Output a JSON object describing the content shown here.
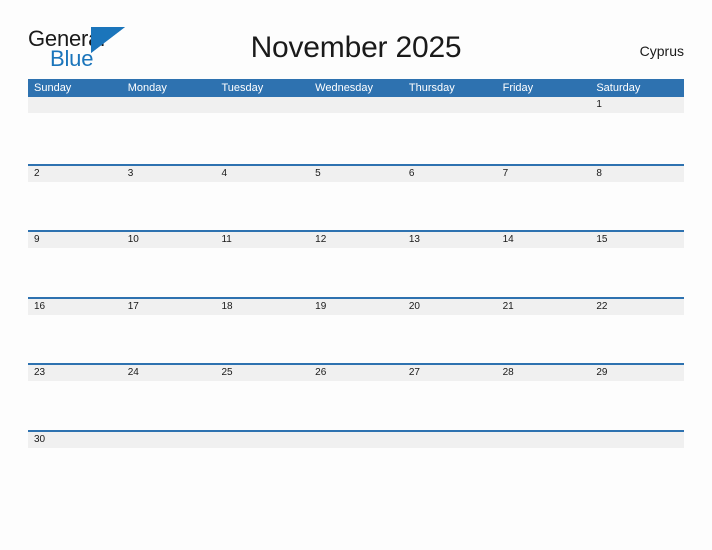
{
  "brand": {
    "text_primary": "General",
    "text_secondary": "Blue",
    "mark_icon": "triangle-flag-icon",
    "color_primary": "#1a1a1a",
    "color_secondary": "#1b75bb"
  },
  "header": {
    "title": "November 2025",
    "locale": "Cyprus"
  },
  "theme": {
    "accent": "#2e72b0",
    "date_band": "#f0f0f0",
    "page_background": "#fdfdfd",
    "text": "#1a1a1a",
    "header_text": "#ffffff"
  },
  "calendar": {
    "month": "November",
    "year": "2025",
    "weekdays": [
      "Sunday",
      "Monday",
      "Tuesday",
      "Wednesday",
      "Thursday",
      "Friday",
      "Saturday"
    ],
    "weeks": [
      {
        "days": [
          {
            "label": ""
          },
          {
            "label": ""
          },
          {
            "label": ""
          },
          {
            "label": ""
          },
          {
            "label": ""
          },
          {
            "label": ""
          },
          {
            "label": "1"
          }
        ]
      },
      {
        "days": [
          {
            "label": "2"
          },
          {
            "label": "3"
          },
          {
            "label": "4"
          },
          {
            "label": "5"
          },
          {
            "label": "6"
          },
          {
            "label": "7"
          },
          {
            "label": "8"
          }
        ]
      },
      {
        "days": [
          {
            "label": "9"
          },
          {
            "label": "10"
          },
          {
            "label": "11"
          },
          {
            "label": "12"
          },
          {
            "label": "13"
          },
          {
            "label": "14"
          },
          {
            "label": "15"
          }
        ]
      },
      {
        "days": [
          {
            "label": "16"
          },
          {
            "label": "17"
          },
          {
            "label": "18"
          },
          {
            "label": "19"
          },
          {
            "label": "20"
          },
          {
            "label": "21"
          },
          {
            "label": "22"
          }
        ]
      },
      {
        "days": [
          {
            "label": "23"
          },
          {
            "label": "24"
          },
          {
            "label": "25"
          },
          {
            "label": "26"
          },
          {
            "label": "27"
          },
          {
            "label": "28"
          },
          {
            "label": "29"
          }
        ]
      },
      {
        "days": [
          {
            "label": "30"
          },
          {
            "label": ""
          },
          {
            "label": ""
          },
          {
            "label": ""
          },
          {
            "label": ""
          },
          {
            "label": ""
          },
          {
            "label": ""
          }
        ]
      }
    ]
  }
}
